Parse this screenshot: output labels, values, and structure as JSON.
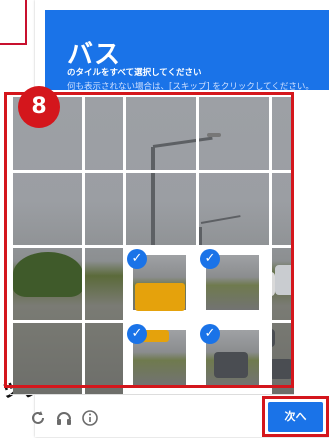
{
  "outside": {
    "partial_text": "ック"
  },
  "header": {
    "title": "バス",
    "subtitle": "のタイルをすべて選択してください",
    "note": "何も表示されない場合は、[スキップ] をクリックしてください。"
  },
  "step_badge": "8",
  "grid": {
    "rows": 4,
    "cols": 4,
    "selected_tiles": [
      "r3c2",
      "r3c3",
      "r4c2",
      "r4c3"
    ]
  },
  "footer": {
    "icons": [
      "reload-icon",
      "audio-icon",
      "info-icon"
    ],
    "next_label": "次へ"
  },
  "colors": {
    "header_bg": "#1a73e8",
    "highlight_red": "#d4161c",
    "check_blue": "#1a73e8"
  }
}
